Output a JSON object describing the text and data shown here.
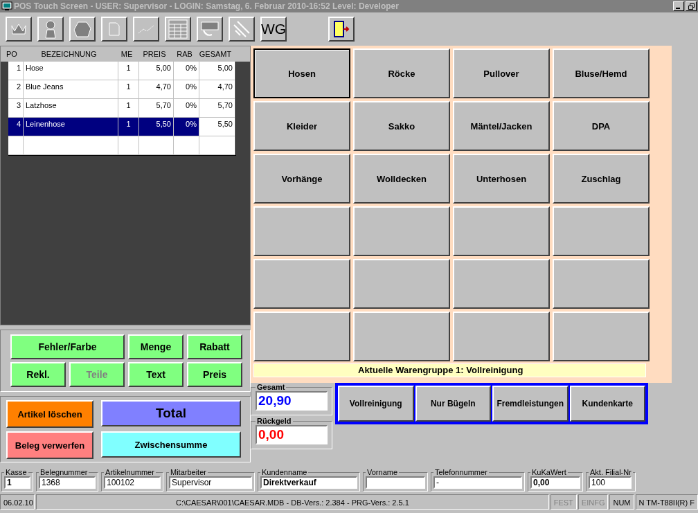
{
  "window": {
    "title": "POS Touch Screen - USER: Supervisor - LOGIN: Samstag, 6. Februar 2010-16:52 Level: Developer"
  },
  "toolbar": {
    "text_button": "WG"
  },
  "table": {
    "columns": [
      "PO",
      "BEZEICHNUNG",
      "ME",
      "PREIS",
      "RAB",
      "GESAMT"
    ],
    "rows": [
      {
        "cells": [
          "1",
          "Hose",
          "1",
          "5,00",
          "0%",
          "5,00"
        ],
        "selected": false
      },
      {
        "cells": [
          "2",
          "Blue Jeans",
          "1",
          "4,70",
          "0%",
          "4,70"
        ],
        "selected": false
      },
      {
        "cells": [
          "3",
          "Latzhose",
          "1",
          "5,70",
          "0%",
          "5,70"
        ],
        "selected": false
      },
      {
        "cells": [
          "4",
          "Leinenhose",
          "1",
          "5,50",
          "0%",
          "5,50"
        ],
        "selected": true
      }
    ]
  },
  "edit_buttons": [
    {
      "label": "Fehler/Farbe",
      "wide": true,
      "disabled": false
    },
    {
      "label": "Menge",
      "wide": false,
      "disabled": false
    },
    {
      "label": "Rabatt",
      "wide": false,
      "disabled": false
    },
    {
      "label": "Rekl.",
      "wide": false,
      "disabled": false
    },
    {
      "label": "Teile",
      "wide": false,
      "disabled": true
    },
    {
      "label": "Text",
      "wide": false,
      "disabled": false
    },
    {
      "label": "Preis",
      "wide": false,
      "disabled": false
    }
  ],
  "action_buttons": [
    {
      "label": "Artikel löschen",
      "color": "#ff8000",
      "kind": "small"
    },
    {
      "label": "Total",
      "color": "#8080ff",
      "kind": "large"
    },
    {
      "label": "Beleg verwerfen",
      "color": "#ff8080",
      "kind": "small"
    },
    {
      "label": "Zwischensumme",
      "color": "#80ffff",
      "kind": "medium"
    }
  ],
  "article_buttons": [
    {
      "label": "Hosen",
      "selected": true
    },
    {
      "label": "Röcke",
      "selected": false
    },
    {
      "label": "Pullover",
      "selected": false
    },
    {
      "label": "Bluse/Hemd",
      "selected": false
    },
    {
      "label": "Kleider",
      "selected": false
    },
    {
      "label": "Sakko",
      "selected": false
    },
    {
      "label": "Mäntel/Jacken",
      "selected": false
    },
    {
      "label": "DPA",
      "selected": false
    },
    {
      "label": "Vorhänge",
      "selected": false
    },
    {
      "label": "Wolldecken",
      "selected": false
    },
    {
      "label": "Unterhosen",
      "selected": false
    },
    {
      "label": "Zuschlag",
      "selected": false
    }
  ],
  "group_status": "Aktuelle Warengruppe 1: Vollreinigung",
  "totals": [
    {
      "label": "Gesamt",
      "value": "20,90",
      "color": "#0000ff"
    },
    {
      "label": "Rückgeld",
      "value": "0,00",
      "color": "#ff0000"
    }
  ],
  "group_buttons": [
    "Vollreinigung",
    "Nur Bügeln",
    "Fremdleistungen",
    "Kundenkarte"
  ],
  "fields": [
    {
      "label": "Kasse",
      "value": "1",
      "bold": true
    },
    {
      "label": "Belegnummer",
      "value": "1368",
      "bold": false
    },
    {
      "label": "Artikelnummer",
      "value": "100102",
      "bold": false
    },
    {
      "label": "Mitarbeiter",
      "value": "Supervisor",
      "bold": false
    },
    {
      "label": "Kundenname",
      "value": "Direktverkauf",
      "bold": true
    },
    {
      "label": "Vorname"
    },
    {
      "label": "Telefonnummer",
      "value": "-",
      "bold": false
    },
    {
      "label": "KuKaWert",
      "value": "0,00",
      "bold": true
    },
    {
      "label": "Akt. Filial-Nr",
      "value": "100",
      "bold": false
    }
  ],
  "status_bar": {
    "date": "06.02.10",
    "info": "C:\\CAESAR\\001\\CAESAR.MDB - DB-Vers.:  2.384 - PRG-Vers.: 2.5.1",
    "indicators": [
      {
        "label": "FEST",
        "disabled": true
      },
      {
        "label": "EINFG",
        "disabled": true
      },
      {
        "label": "NUM",
        "disabled": false
      },
      {
        "label": "N TM-T88II(R) F",
        "disabled": false
      }
    ]
  }
}
